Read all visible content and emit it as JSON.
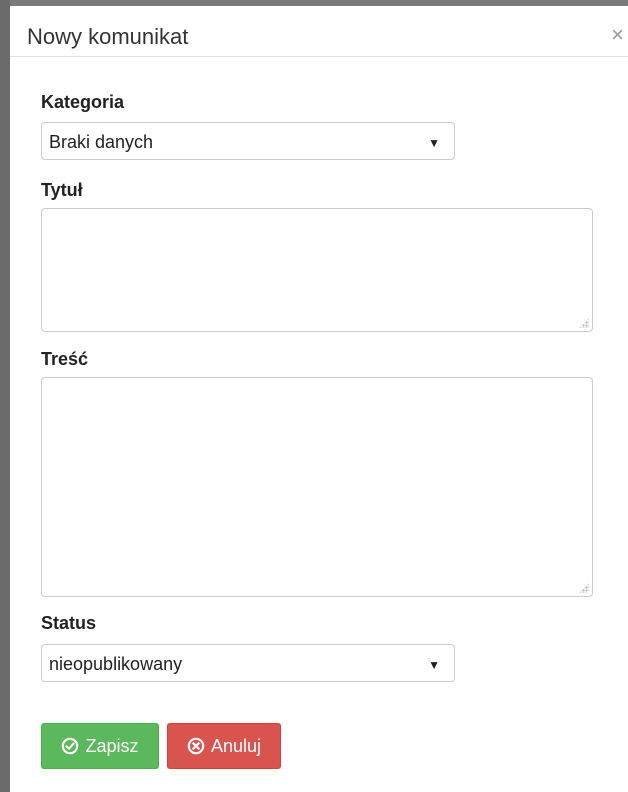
{
  "modal": {
    "title": "Nowy komunikat",
    "close_glyph": "×"
  },
  "form": {
    "category": {
      "label": "Kategoria",
      "value": "Braki danych",
      "caret": "▼"
    },
    "title_field": {
      "label": "Tytuł",
      "value": ""
    },
    "content_field": {
      "label": "Treść",
      "value": ""
    },
    "status": {
      "label": "Status",
      "value": "nieopublikowany",
      "caret": "▼"
    }
  },
  "actions": {
    "save_label": "Zapisz",
    "save_icon": "check-circle-icon",
    "cancel_label": "Anuluj",
    "cancel_icon": "times-circle-icon"
  },
  "colors": {
    "save": "#5cb85c",
    "cancel": "#d9534f"
  }
}
